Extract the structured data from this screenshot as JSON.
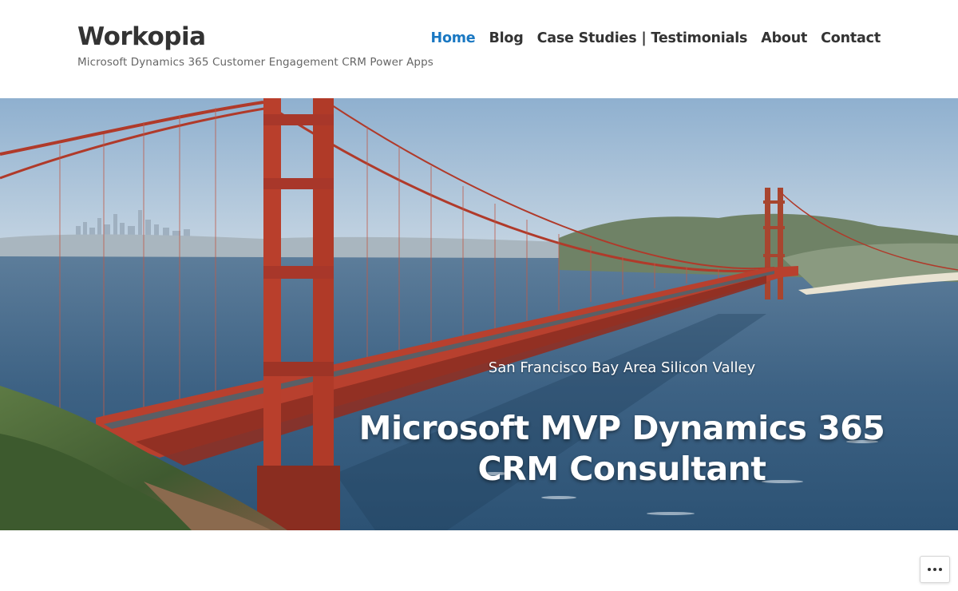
{
  "site": {
    "title": "Workopia",
    "description": "Microsoft Dynamics 365 Customer Engagement CRM Power Apps"
  },
  "nav": {
    "items": [
      {
        "label": "Home",
        "active": true
      },
      {
        "label": "Blog",
        "active": false
      },
      {
        "label": "Case Studies | Testimonials",
        "active": false
      },
      {
        "label": "About",
        "active": false
      },
      {
        "label": "Contact",
        "active": false
      }
    ]
  },
  "hero": {
    "subtitle": "San Francisco Bay Area Silicon Valley",
    "title": "Microsoft MVP Dynamics 365 CRM Consultant",
    "image": "golden-gate-bridge-photo"
  },
  "actions": {
    "more_icon": "ellipsis-icon"
  },
  "colors": {
    "accent": "#1a78c2",
    "text": "#333333",
    "bridge": "#c0392b"
  }
}
